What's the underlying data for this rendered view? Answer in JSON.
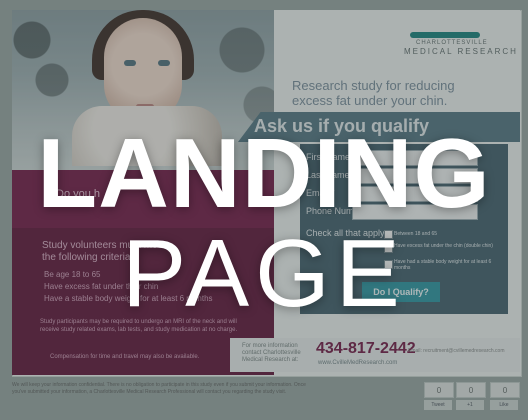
{
  "overlay": {
    "line1": "LANDING",
    "line2": "PAGE"
  },
  "brand": {
    "line1": "CHARLOTTESVILLE",
    "line2": "MEDICAL RESEARCH",
    "color": "#2a8a85"
  },
  "hero": {
    "headline": "Research study for reducing excess fat under your chin."
  },
  "banner": {
    "text": "Ask us if you qualify"
  },
  "promo": {
    "text": "Do you h"
  },
  "criteria": {
    "title": "Study volunteers must meet the following criteria:",
    "items": [
      "Be age 18 to 65",
      "Have excess fat under their chin",
      "Have a stable body weight for at least 6 months"
    ]
  },
  "info": {
    "paragraph": "Study participants may be required to undergo an MRI of the neck and will receive study related exams, lab tests, and study medication at no charge.",
    "compensation": "Compensation for time and travel may also be available."
  },
  "form": {
    "fields": [
      {
        "label": "First Name *"
      },
      {
        "label": "Last Name *"
      },
      {
        "label": "Email *"
      },
      {
        "label": "Phone Number"
      }
    ],
    "check_all_label": "Check all that apply",
    "checkboxes": [
      "Between 18 and 65",
      "Have excess fat under the chin (double chin)",
      "Have had a stable body weight for at least 6 months"
    ],
    "submit": "Do I Qualify?"
  },
  "contact": {
    "info": "For more information contact Charlottesville Medical Research at:",
    "phone": "434-817-2442",
    "web": "www.CvilleMedResearch.com",
    "email": "Email: recruitment@cvillemedresearch.com"
  },
  "disclaimer": "We will keep your information confidential. There is no obligation to participate in this study even if you submit your information. Once you've submitted your information, a Charlottesville Medical Research Professional will contact you regarding the study visit.",
  "social": {
    "counts": [
      "0",
      "0",
      "0"
    ],
    "buttons": [
      "Tweet",
      "+1",
      "Like"
    ]
  }
}
